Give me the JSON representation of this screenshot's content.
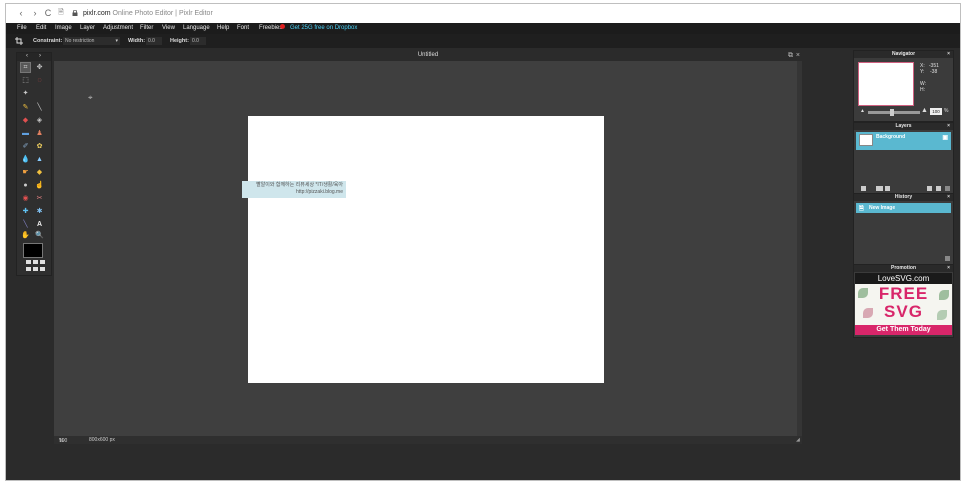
{
  "browser": {
    "url_domain": "pixlr.com",
    "page_title": "Online Photo Editor | Pixlr Editor",
    "back": "‹",
    "forward": "›",
    "reload": "C",
    "tab_icon": "🗎"
  },
  "menu": {
    "items": [
      "File",
      "Edit",
      "Image",
      "Layer",
      "Adjustment",
      "Filter",
      "View",
      "Language",
      "Help",
      "Font",
      "Freebies"
    ],
    "promo": "Get 25G free on Dropbox"
  },
  "options": {
    "constraint_label": "Constraint:",
    "constraint_value": "No restriction",
    "width_label": "Width:",
    "width_value": "0.0",
    "height_label": "Height:",
    "height_value": "0.0"
  },
  "canvas": {
    "title": "Untitled",
    "watermark_line1": "빨알이와 함께하는 리뷰세상 *IT/생활/육아",
    "watermark_line2": "http://pizzaki.blog.me",
    "zoom": "100",
    "zoom_unit": "%",
    "dimensions": "800x600 px"
  },
  "navigator": {
    "title": "Navigator",
    "close": "×",
    "coords": "X:   -351\nY:    -38\n\nW:\nH:",
    "zoom_value": "100",
    "zoom_unit": "%"
  },
  "layers": {
    "title": "Layers",
    "close": "×",
    "items": [
      "Background"
    ]
  },
  "history": {
    "title": "History",
    "close": "×",
    "items": [
      "New Image"
    ]
  },
  "promotion": {
    "title": "Promotion",
    "close": "×",
    "brand": "LoveSVG.com",
    "headline1": "FREE",
    "headline2": "SVG",
    "cta": "Get Them Today"
  },
  "colors": {
    "accent": "#5ab8d0",
    "promo_link": "#4ad0f5",
    "ad_pink": "#d8266a"
  }
}
